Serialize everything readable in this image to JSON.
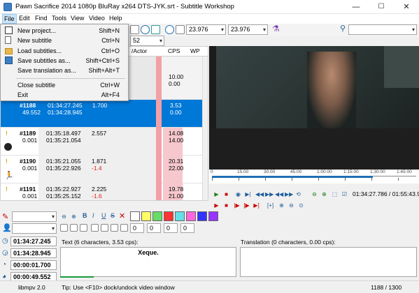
{
  "window": {
    "title": "Pawn Sacrifice 2014 1080p BluRay x264 DTS-JYK.srt - Subtitle Workshop",
    "min": "—",
    "max": "☐",
    "close": "✕"
  },
  "menu": [
    "File",
    "Edit",
    "Find",
    "Tools",
    "View",
    "Video",
    "Help"
  ],
  "file_menu": [
    {
      "label": "New project...",
      "shortcut": "Shift+N",
      "icon": "new-project-icon"
    },
    {
      "label": "New subtitle",
      "shortcut": "Ctrl+N",
      "icon": "new-subtitle-icon"
    },
    {
      "label": "Load subtitles...",
      "shortcut": "Ctrl+O",
      "icon": "folder-icon"
    },
    {
      "label": "Save subtitles as...",
      "shortcut": "Shift+Ctrl+S",
      "icon": "save-icon"
    },
    {
      "label": "Save translation as...",
      "shortcut": "Shift+Alt+T",
      "icon": ""
    },
    {
      "label": "Close subtitle",
      "shortcut": "Ctrl+W",
      "icon": ""
    },
    {
      "label": "Exit",
      "shortcut": "Alt+F4",
      "icon": ""
    }
  ],
  "toolbar": {
    "fps1": "23.976",
    "fps2": "23.976",
    "combo3": "52"
  },
  "grid": {
    "headers": {
      "actor": "/Actor",
      "cps": "CPS",
      "wpm": "WP"
    },
    "rows": [
      {
        "num": "",
        "sub": "",
        "start": "",
        "end": "",
        "dur": "",
        "delta": "",
        "cps": "10.00",
        "cps2": "0.00",
        "wpm": "",
        "warn": false,
        "selected": false
      },
      {
        "num": "#1188",
        "sub": "49.552",
        "start": "01:34:27.245",
        "end": "01:34:28.945",
        "dur": "1.700",
        "delta": "",
        "cps": "3.53",
        "cps2": "0.00",
        "wpm": "",
        "warn": false,
        "selected": true
      },
      {
        "num": "#1189",
        "sub": "0.001",
        "start": "01:35:18.497",
        "end": "01:35:21.054",
        "dur": "2.557",
        "delta": "",
        "cps": "14.08",
        "cps2": "14.00",
        "wpm": "",
        "warn": true,
        "selected": false
      },
      {
        "num": "#1190",
        "sub": "0.001",
        "start": "01:35:21.055",
        "end": "01:35:22.926",
        "dur": "1.871",
        "delta": "-1.4",
        "cps": "20.31",
        "cps2": "22.00",
        "wpm": "",
        "warn": true,
        "selected": false
      },
      {
        "num": "#1191",
        "sub": "0.001",
        "start": "01:35:22.927",
        "end": "01:35:25.152",
        "dur": "2.225",
        "delta": "-1.6",
        "cps": "19.78",
        "cps2": "21.00",
        "wpm": "",
        "warn": true,
        "selected": false
      }
    ]
  },
  "video": {
    "time_current": "01:34:27.786",
    "time_total": "01:55:43.937",
    "separator": "/",
    "ticks": [
      "0",
      "15:00",
      "30:00",
      "45:00",
      "1:00:00",
      "1:15:00",
      "1:30:00",
      "1:45:00"
    ]
  },
  "editor": {
    "start": "01:34:27.245",
    "end": "01:34:28.945",
    "duration": "00:00:01.700",
    "pause": "00:00:49.552",
    "text_label": "Text (6 characters, 3.53 cps):",
    "text_value": "Xeque.",
    "translation_label": "Translation (0 characters, 0.00 cps):",
    "num_fields": [
      "0",
      "0",
      "0",
      "0"
    ],
    "swatches": [
      "#ffffff",
      "#ffff66",
      "#66dd66",
      "#ff3333",
      "#66e0e6",
      "#ff66dd",
      "#3333ff",
      "#9933ff"
    ]
  },
  "status": {
    "player": "libmpv 2.0",
    "tip": "Tip: Use <F10> dock/undock video window",
    "position": "1188 / 1300"
  }
}
